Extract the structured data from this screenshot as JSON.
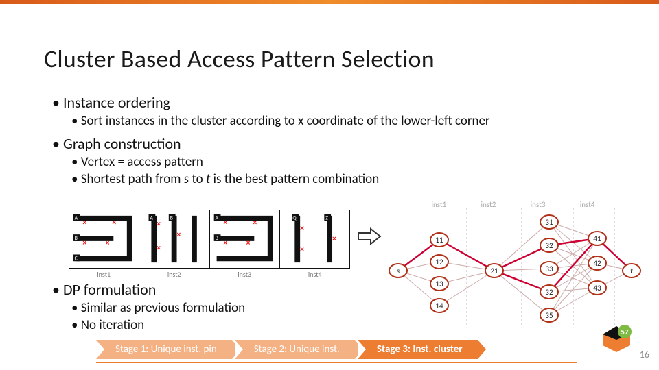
{
  "title": "Cluster Based Access Pattern Selection",
  "bullets": {
    "b1": "Instance ordering",
    "b1a": "Sort instances in the cluster according to x coordinate of the lower-left corner",
    "b2": "Graph construction",
    "b2a": "Vertex = access pattern",
    "b2b_pre": "Shortest path from ",
    "b2b_s": "s",
    "b2b_mid": " to ",
    "b2b_t": "t",
    "b2b_post": " is the best pattern combination",
    "b3": "DP formulation",
    "b3a": "Similar as previous formulation",
    "b3b": "No iteration"
  },
  "patterns": {
    "labels": [
      "inst1",
      "inst2",
      "inst3",
      "inst4"
    ],
    "pins": [
      "A",
      "B",
      "C",
      "A",
      "B",
      "A",
      "B",
      "Q",
      "Z"
    ]
  },
  "graph": {
    "col_labels": [
      "",
      "inst1",
      "inst2",
      "inst3",
      "inst4",
      ""
    ],
    "src": "s",
    "dst": "t",
    "cols": [
      [
        "11",
        "12",
        "13",
        "14"
      ],
      [
        "21"
      ],
      [
        "31",
        "32",
        "33",
        "32",
        "35"
      ],
      [
        "41",
        "42",
        "43"
      ]
    ],
    "shortest_path": [
      "s",
      "11",
      "21",
      "32",
      "41",
      "t"
    ]
  },
  "stages": {
    "s1": "Stage 1: Unique inst. pin",
    "s2": "Stage 2: Unique inst.",
    "s3": "Stage 3: Inst. cluster"
  },
  "logo_badge": "57",
  "page_num": "16",
  "colors": {
    "accent": "#ed7d31",
    "node": "#b03018",
    "edge": "#b03018"
  }
}
